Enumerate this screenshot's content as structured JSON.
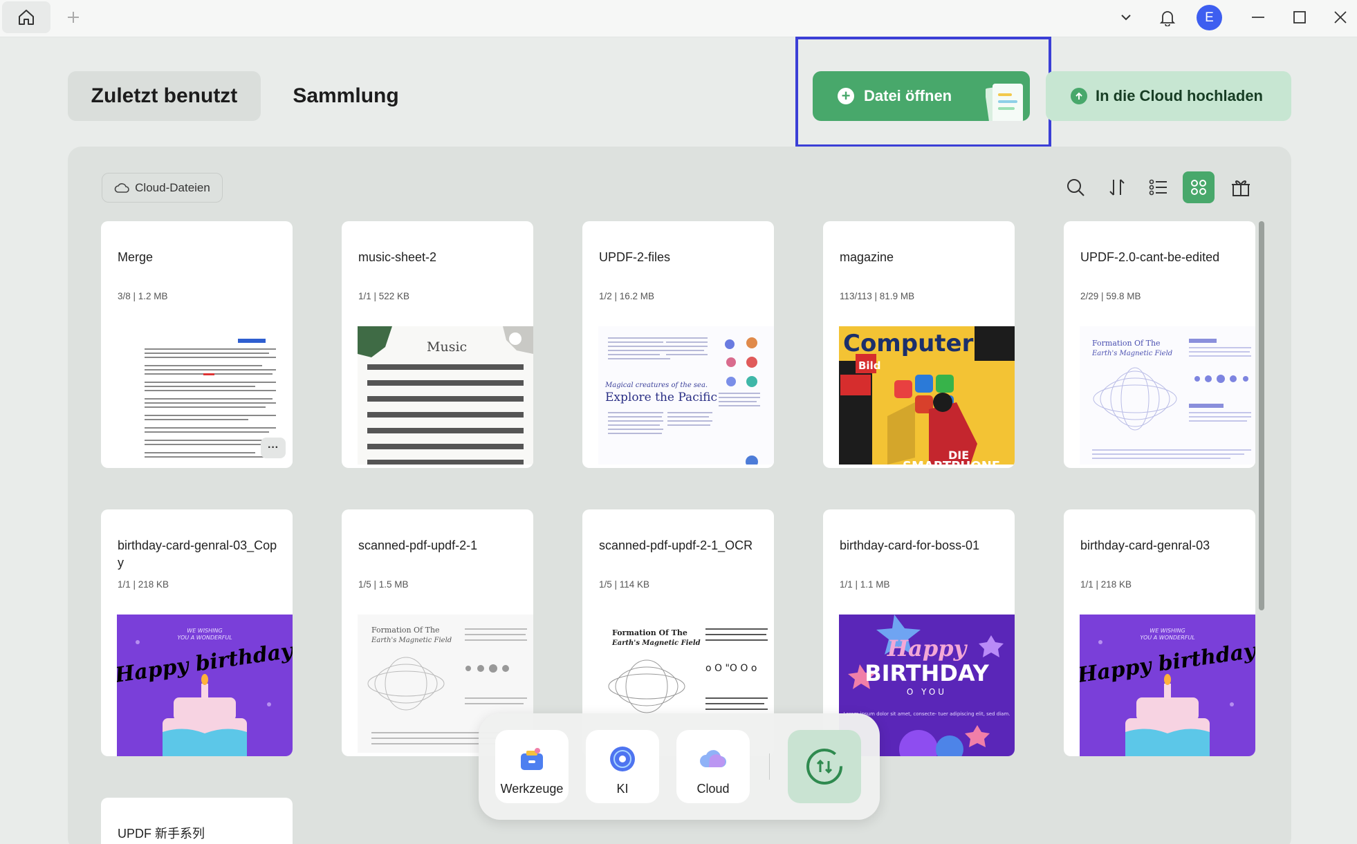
{
  "titlebar": {
    "avatar_letter": "E",
    "icons": [
      "home-icon",
      "plus-icon",
      "chevron-down-icon",
      "bell-icon",
      "minimize-icon",
      "maximize-icon",
      "close-icon"
    ]
  },
  "tabs": {
    "recent": "Zuletzt benutzt",
    "collection": "Sammlung"
  },
  "actions": {
    "open_file": "Datei öffnen",
    "upload_cloud": "In die Cloud hochladen"
  },
  "toolbar": {
    "cloud_files": "Cloud-Dateien"
  },
  "files": [
    {
      "name": "Merge",
      "meta": "3/8 | 1.2 MB"
    },
    {
      "name": "music-sheet-2",
      "meta": "1/1 | 522 KB"
    },
    {
      "name": "UPDF-2-files",
      "meta": "1/2 | 16.2 MB"
    },
    {
      "name": "magazine",
      "meta": "113/113 | 81.9 MB"
    },
    {
      "name": "UPDF-2.0-cant-be-edited",
      "meta": "2/29 | 59.8 MB"
    },
    {
      "name": "birthday-card-genral-03_Copy",
      "meta": "1/1 | 218 KB"
    },
    {
      "name": "scanned-pdf-updf-2-1",
      "meta": "1/5 | 1.5 MB"
    },
    {
      "name": "scanned-pdf-updf-2-1_OCR",
      "meta": "1/5 | 114 KB"
    },
    {
      "name": "birthday-card-for-boss-01",
      "meta": "1/1 | 1.1 MB"
    },
    {
      "name": "birthday-card-genral-03",
      "meta": "1/1 | 218 KB"
    },
    {
      "name": "UPDF 新手系列",
      "meta": ""
    }
  ],
  "thumbs": {
    "music_title": "Music",
    "pacific_sub": "Magical creatures of the sea.",
    "pacific_title": "Explore the Pacific",
    "magazine_title": "Computer",
    "magazine_bild": "Bild",
    "magazine_die": "DIE",
    "magazine_smartphone": "SMARTPHONE",
    "formation_title": "Formation Of The",
    "formation_sub": "Earth's Magnetic Field",
    "bday_wish1": "WE WISHING",
    "bday_wish2": "YOU A WONDERFUL",
    "bday_happy": "Happy birthday",
    "boss_happy": "Happy",
    "boss_birthday": "BIRTHDAY",
    "boss_to_you": "O YOU",
    "boss_lorem": "Lorem ipsum dolor sit amet, consecte- tuer adipiscing elit, sed diam.",
    "ocr_row": "o O \"O O o"
  },
  "dock": {
    "tools": "Werkzeuge",
    "ai": "KI",
    "cloud": "Cloud"
  }
}
